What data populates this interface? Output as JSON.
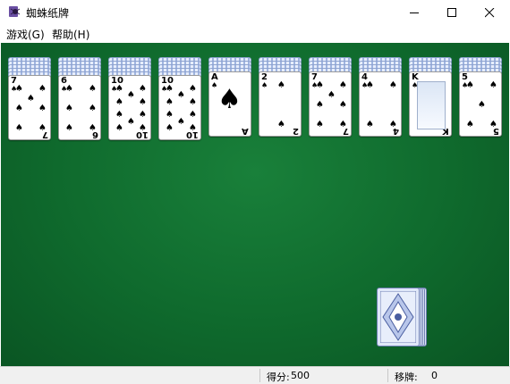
{
  "window": {
    "title": "蜘蛛纸牌"
  },
  "menu": {
    "game": "游戏(G)",
    "help": "帮助(H)"
  },
  "tableau": [
    {
      "rank": "7",
      "suit": "spade",
      "hidden_count": 5
    },
    {
      "rank": "6",
      "suit": "spade",
      "hidden_count": 5
    },
    {
      "rank": "10",
      "suit": "spade",
      "hidden_count": 5
    },
    {
      "rank": "10",
      "suit": "spade",
      "hidden_count": 5
    },
    {
      "rank": "A",
      "suit": "spade",
      "hidden_count": 4
    },
    {
      "rank": "2",
      "suit": "spade",
      "hidden_count": 4
    },
    {
      "rank": "7",
      "suit": "spade",
      "hidden_count": 4
    },
    {
      "rank": "4",
      "suit": "spade",
      "hidden_count": 4
    },
    {
      "rank": "K",
      "suit": "spade",
      "hidden_count": 4
    },
    {
      "rank": "5",
      "suit": "spade",
      "hidden_count": 4
    }
  ],
  "stock": {
    "deals_remaining": 5
  },
  "status": {
    "score_label": "得分:",
    "score_value": "500",
    "moves_label": "移牌:",
    "moves_value": "0"
  },
  "colors": {
    "felt": "#12702f",
    "card_back": "#c9d6f0"
  },
  "icons": {
    "app": "spider-icon"
  }
}
